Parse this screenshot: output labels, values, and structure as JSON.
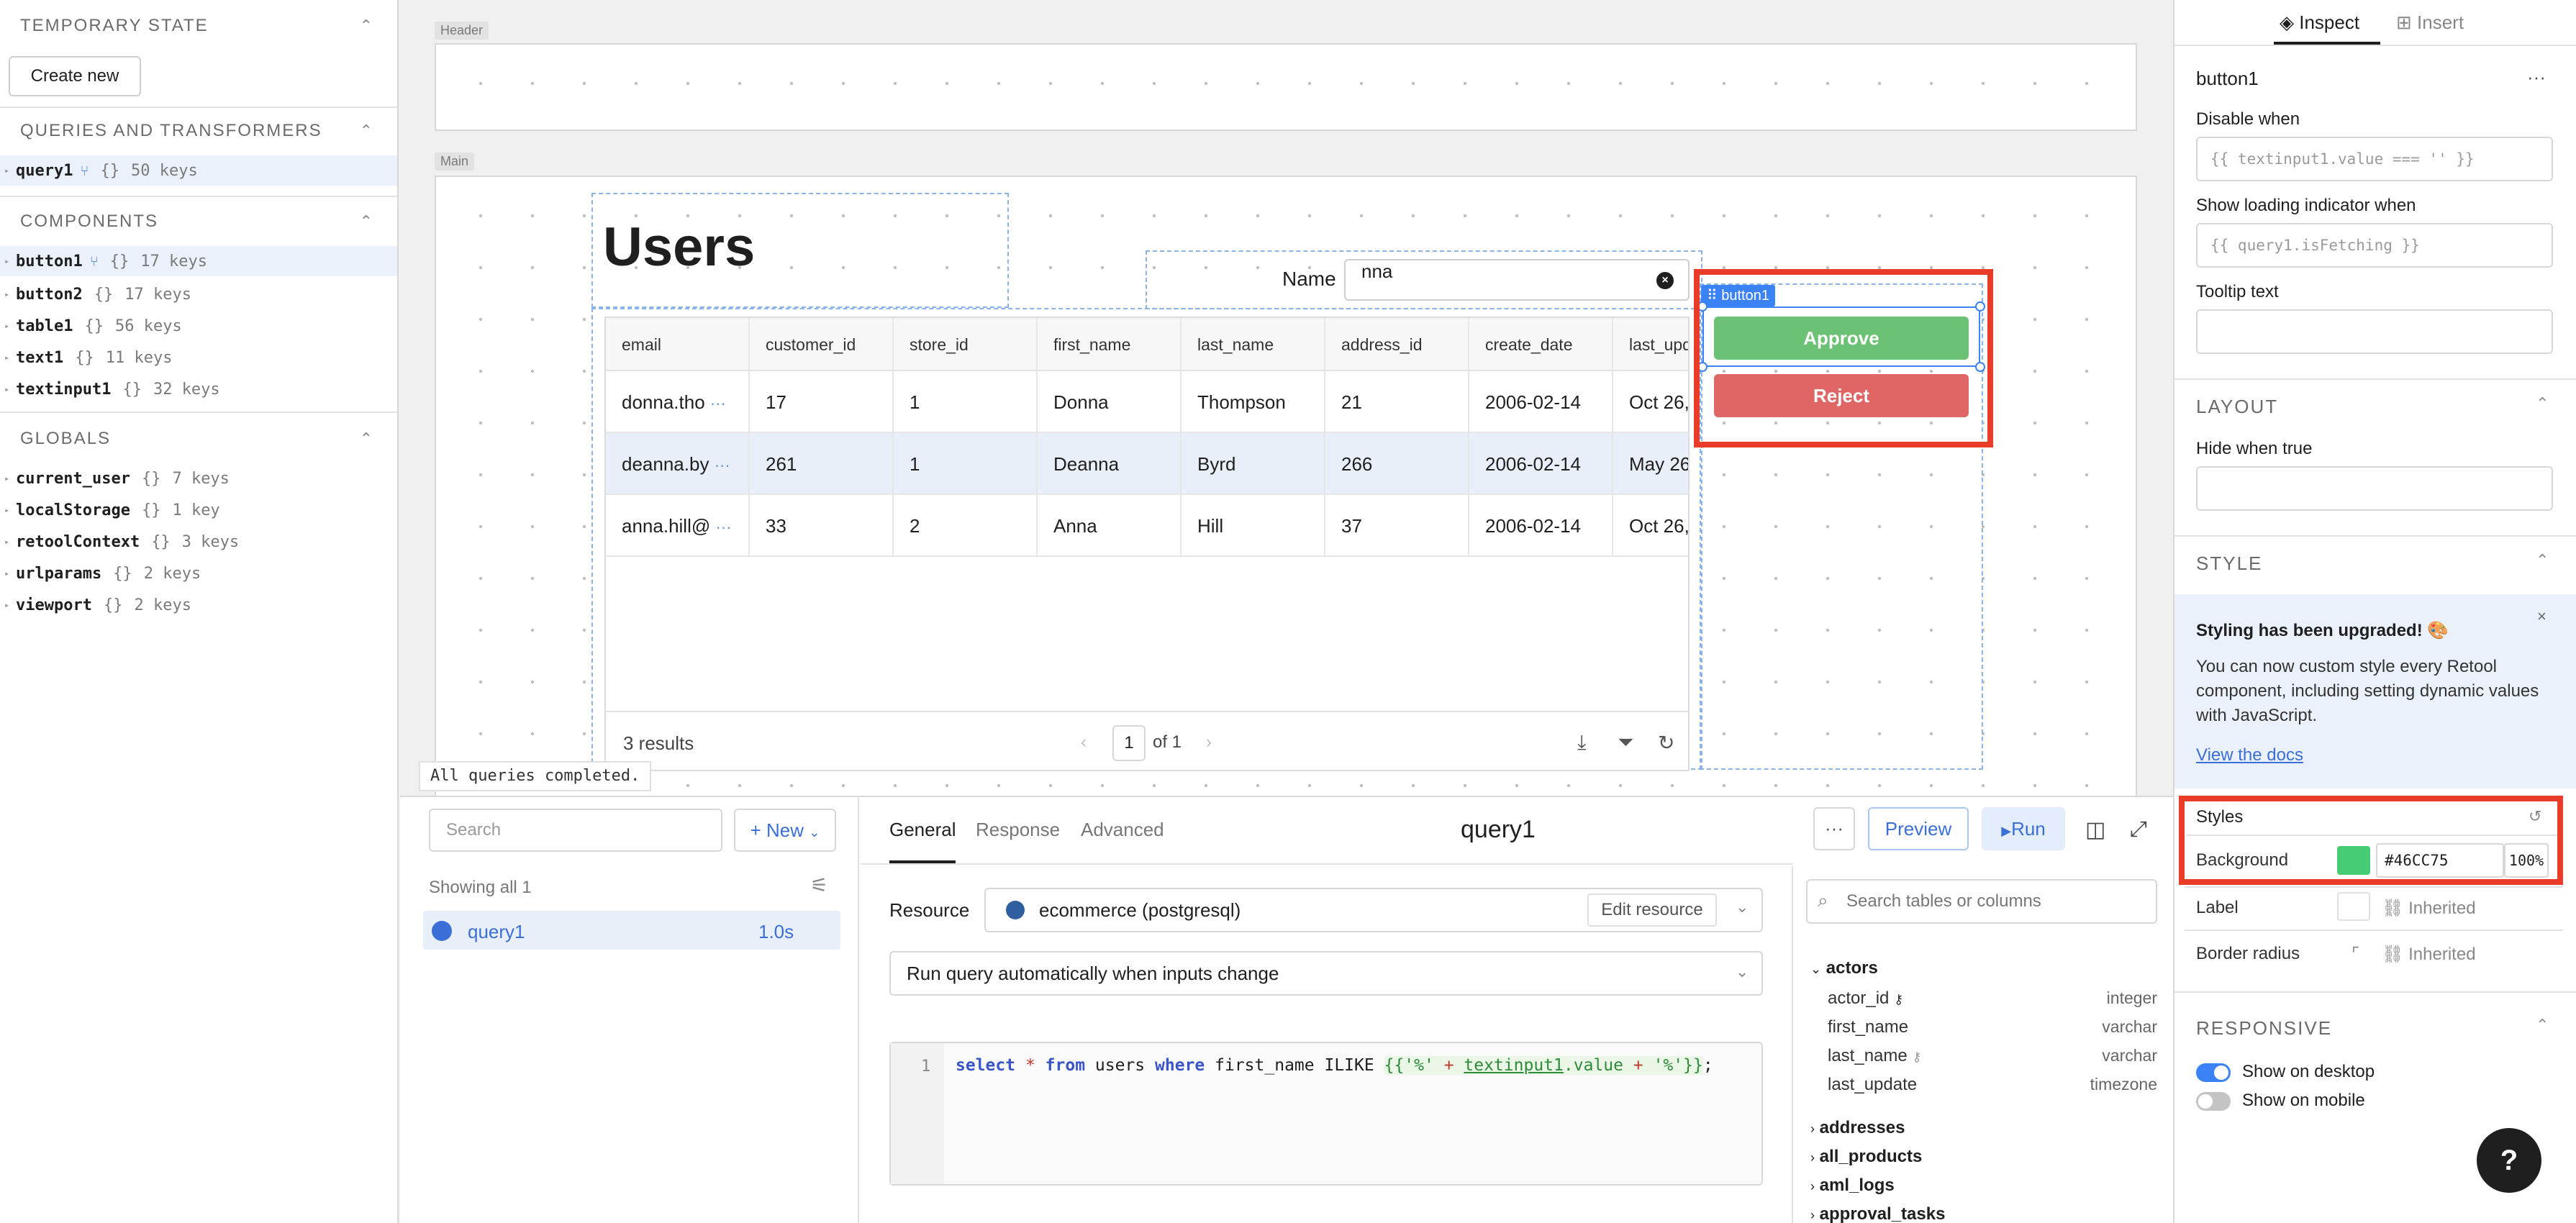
{
  "left_panel": {
    "temporary_state": {
      "title": "TEMPORARY STATE",
      "create_new": "Create new"
    },
    "queries": {
      "title": "QUERIES AND TRANSFORMERS",
      "items": [
        {
          "name": "query1",
          "braces": "{}",
          "keys": "50 keys"
        }
      ]
    },
    "components": {
      "title": "COMPONENTS",
      "items": [
        {
          "name": "button1",
          "braces": "{}",
          "keys": "17 keys"
        },
        {
          "name": "button2",
          "braces": "{}",
          "keys": "17 keys"
        },
        {
          "name": "table1",
          "braces": "{}",
          "keys": "56 keys"
        },
        {
          "name": "text1",
          "braces": "{}",
          "keys": "11 keys"
        },
        {
          "name": "textinput1",
          "braces": "{}",
          "keys": "32 keys"
        }
      ]
    },
    "globals": {
      "title": "GLOBALS",
      "items": [
        {
          "name": "current_user",
          "braces": "{}",
          "keys": "7 keys"
        },
        {
          "name": "localStorage",
          "braces": "{}",
          "keys": "1 key"
        },
        {
          "name": "retoolContext",
          "braces": "{}",
          "keys": "3 keys"
        },
        {
          "name": "urlparams",
          "braces": "{}",
          "keys": "2 keys"
        },
        {
          "name": "viewport",
          "braces": "{}",
          "keys": "2 keys"
        }
      ]
    }
  },
  "canvas": {
    "header_label": "Header",
    "main_label": "Main",
    "title": "Users",
    "name_label": "Name",
    "name_value": "nna",
    "table": {
      "columns": [
        "email",
        "customer_id",
        "store_id",
        "first_name",
        "last_name",
        "address_id",
        "create_date",
        "last_upd"
      ],
      "rows": [
        [
          "donna.tho",
          "17",
          "1",
          "Donna",
          "Thompson",
          "21",
          "2006-02-14",
          "Oct 26,"
        ],
        [
          "deanna.by",
          "261",
          "1",
          "Deanna",
          "Byrd",
          "266",
          "2006-02-14",
          "May 26"
        ],
        [
          "anna.hill@",
          "33",
          "2",
          "Anna",
          "Hill",
          "37",
          "2006-02-14",
          "Oct 26,"
        ]
      ],
      "results": "3 results",
      "page": "1",
      "page_of": "of 1"
    },
    "button1_tag": "button1",
    "approve_label": "Approve",
    "reject_label": "Reject",
    "status": "All queries completed."
  },
  "query_panel": {
    "search_placeholder": "Search",
    "new_label": "+ New",
    "showing": "Showing all 1",
    "query": {
      "name": "query1",
      "time": "1.0s"
    },
    "tabs": [
      "General",
      "Response",
      "Advanced"
    ],
    "title": "query1",
    "more": "···",
    "preview": "Preview",
    "run": "Run",
    "resource_label": "Resource",
    "resource_name": "ecommerce (postgresql)",
    "edit_resource": "Edit resource",
    "run_mode": "Run query automatically when inputs change",
    "line_number": "1",
    "sql": {
      "k1": "select",
      "star": "*",
      "k2": "from",
      "tbl": "users",
      "k3": "where",
      "col": "first_name",
      "k4": "ILIKE",
      "t_open": "{{",
      "s1": "'%'",
      "plus1": "+",
      "var": "textinput1",
      "prop": ".value",
      "plus2": "+",
      "s2": "'%'",
      "t_close": "}}",
      "semi": ";"
    },
    "schema": {
      "search_placeholder": "Search tables or columns",
      "open_table": "actors",
      "columns": [
        {
          "name": "actor_id",
          "type": "integer"
        },
        {
          "name": "first_name",
          "type": "varchar"
        },
        {
          "name": "last_name",
          "type": "varchar"
        },
        {
          "name": "last_update",
          "type": "timezone"
        }
      ],
      "tables": [
        "addresses",
        "all_products",
        "aml_logs",
        "approval_tasks"
      ]
    }
  },
  "inspector": {
    "tabs": [
      "Inspect",
      "Insert"
    ],
    "component": "button1",
    "more": "···",
    "disable_when": {
      "label": "Disable when",
      "placeholder": "{{ textinput1.value === '' }}"
    },
    "loading": {
      "label": "Show loading indicator when",
      "placeholder": "{{ query1.isFetching }}"
    },
    "tooltip": {
      "label": "Tooltip text"
    },
    "layout": {
      "title": "LAYOUT",
      "hide_label": "Hide when true"
    },
    "style": {
      "title": "STYLE",
      "notice_title": "Styling has been upgraded! 🎨",
      "notice_body": "You can now custom style every Retool component, including setting dynamic values with JavaScript.",
      "notice_link": "View the docs",
      "styles_title": "Styles",
      "background_label": "Background",
      "background_hex": "#46CC75",
      "background_alpha": "100%",
      "label_label": "Label",
      "label_value": "Inherited",
      "radius_label": "Border radius",
      "radius_value": "Inherited"
    },
    "responsive": {
      "title": "RESPONSIVE",
      "desktop": "Show on desktop",
      "mobile": "Show on mobile"
    },
    "help": "?"
  },
  "colors": {
    "approve": "#6cc274",
    "reject": "#e06666",
    "accent": "#3b82f6",
    "highlight": "#ea3a28",
    "background_swatch": "#46cc75"
  }
}
